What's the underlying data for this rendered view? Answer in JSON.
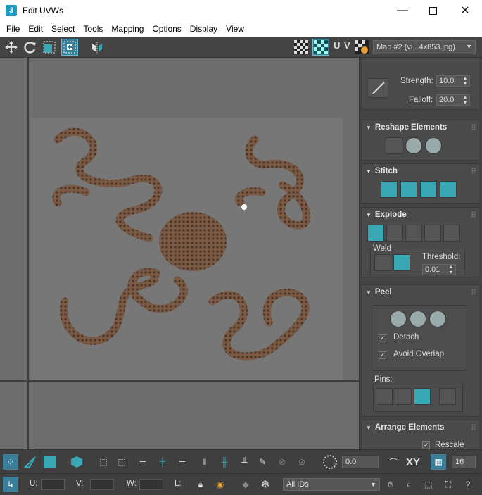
{
  "window": {
    "app_icon": "3",
    "title": "Edit UVWs",
    "controls": [
      "minimize-icon",
      "maximize-icon",
      "close-icon"
    ]
  },
  "menu": [
    "File",
    "Edit",
    "Select",
    "Tools",
    "Mapping",
    "Options",
    "Display",
    "View"
  ],
  "toolbar": {
    "uv_label": "U V",
    "map_select": "Map #2 (vi...4x853.jpg)"
  },
  "panel": {
    "brush": {
      "strength_label": "Strength:",
      "strength_value": "10.0",
      "falloff_label": "Falloff:",
      "falloff_value": "20.0"
    },
    "reshape": {
      "title": "Reshape Elements"
    },
    "stitch": {
      "title": "Stitch"
    },
    "explode": {
      "title": "Explode",
      "weld_label": "Weld",
      "threshold_label": "Threshold:",
      "threshold_value": "0.01"
    },
    "peel": {
      "title": "Peel",
      "detach_label": "Detach",
      "detach_checked": true,
      "avoid_overlap_label": "Avoid Overlap",
      "avoid_overlap_checked": true,
      "pins_label": "Pins:"
    },
    "arrange": {
      "title": "Arrange Elements",
      "rescale_label": "Rescale",
      "rescale_checked": true
    }
  },
  "bottom": {
    "rotate_value": "0.0",
    "xy_label": "XY",
    "grid_value": "16",
    "u_label": "U:",
    "v_label": "V:",
    "w_label": "W:",
    "l_label": "L:",
    "ids_select": "All IDs"
  },
  "colors": {
    "accent": "#3aa7b5",
    "viewport": "#6d6d6d",
    "panel": "#444444"
  }
}
